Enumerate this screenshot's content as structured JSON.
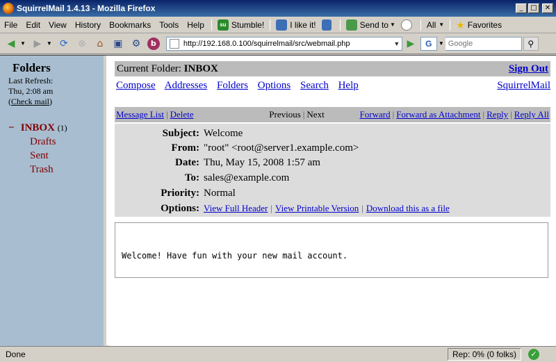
{
  "window": {
    "title": "SquirrelMail 1.4.13 - Mozilla Firefox",
    "controls": [
      "_",
      "□",
      "✕"
    ]
  },
  "menubar": {
    "items": [
      "File",
      "Edit",
      "View",
      "History",
      "Bookmarks",
      "Tools",
      "Help"
    ],
    "stumble": "Stumble!",
    "ilike": "I like it!",
    "sendto": "Send to",
    "all": "All",
    "favorites": "Favorites"
  },
  "navbar": {
    "url": "http://192.168.0.100/squirrelmail/src/webmail.php",
    "search_placeholder": "Google"
  },
  "sidebar": {
    "title": "Folders",
    "last_refresh_label": "Last Refresh:",
    "last_refresh_time": "Thu, 2:08 am",
    "check_mail": "Check mail",
    "folders": [
      {
        "name": "INBOX",
        "count": "(1)"
      },
      {
        "name": "Drafts"
      },
      {
        "name": "Sent"
      },
      {
        "name": "Trash"
      }
    ]
  },
  "main": {
    "current_folder_label": "Current Folder:",
    "current_folder": "INBOX",
    "sign_out": "Sign Out",
    "menu": [
      "Compose",
      "Addresses",
      "Folders",
      "Options",
      "Search",
      "Help"
    ],
    "brand": "SquirrelMail",
    "message_list": "Message List",
    "delete": "Delete",
    "previous": "Previous",
    "next": "Next",
    "forward": "Forward",
    "forward_attachment": "Forward as Attachment",
    "reply": "Reply",
    "reply_all": "Reply All",
    "headers": {
      "subject_label": "Subject:",
      "subject": "Welcome",
      "from_label": "From:",
      "from": "\"root\" <root@server1.example.com>",
      "date_label": "Date:",
      "date": "Thu, May 15, 2008 1:57 am",
      "to_label": "To:",
      "to": "sales@example.com",
      "priority_label": "Priority:",
      "priority": "Normal",
      "options_label": "Options:",
      "view_full_header": "View Full Header",
      "view_printable": "View Printable Version",
      "download_file": "Download this as a file"
    },
    "body": "Welcome! Have fun with your new mail account."
  },
  "statusbar": {
    "status": "Done",
    "rep": "Rep: 0% (0 folks)"
  }
}
